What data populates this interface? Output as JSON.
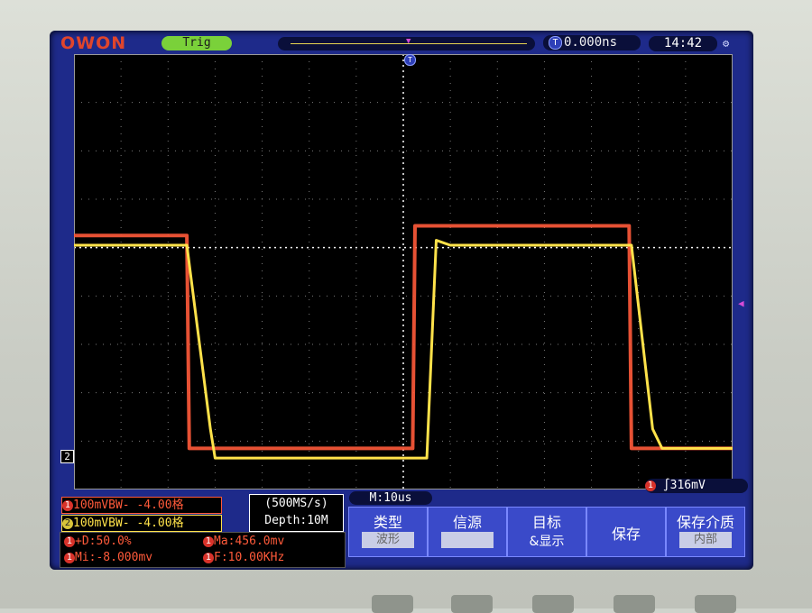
{
  "brand": "OWON",
  "trigger_status": "Trig",
  "trigger_offset": "0.000ns",
  "clock": "14:42",
  "channel1": {
    "marker": "1",
    "setting": "100mVBW- -4.00格",
    "color": "#ff5a3a"
  },
  "channel2": {
    "marker": "2",
    "setting": "100mVBW- -4.00格",
    "color": "#ffe24a"
  },
  "sample_rate": "(500MS/s)",
  "depth": "Depth:10M",
  "timebase": "M:10us",
  "trigger_config": {
    "source": "1",
    "level": "316mV"
  },
  "measurements": {
    "duty": "+D:50.0%",
    "max": "Ma:456.0mv",
    "min": "Mi:-8.000mv",
    "freq": "F:10.00KHz",
    "source": "1"
  },
  "menu": [
    {
      "title": "类型",
      "sub": "波形"
    },
    {
      "title": "信源",
      "sub": ""
    },
    {
      "title": "目标",
      "sub": "&显示"
    },
    {
      "title": "保存",
      "sub": ""
    },
    {
      "title": "保存介质",
      "sub": "内部"
    }
  ],
  "chart_data": {
    "type": "line",
    "title": "",
    "xlabel": "",
    "ylabel": "",
    "grid": true,
    "x_divisions": 14,
    "y_divisions": 9,
    "x_units_per_div": "10us",
    "series": [
      {
        "color": "#ff5a3a",
        "x": [
          0,
          2.4,
          2.45,
          7.2,
          7.25,
          11.8,
          11.85,
          14
        ],
        "y": [
          4.4,
          4.4,
          0.0,
          0.0,
          4.6,
          4.6,
          0.0,
          0.0
        ]
      },
      {
        "color": "#ffe24a",
        "x": [
          0,
          2.4,
          2.9,
          3.0,
          7.5,
          7.7,
          8.0,
          11.85,
          12.3,
          12.5,
          14
        ],
        "y": [
          4.2,
          4.2,
          0.4,
          -0.2,
          -0.2,
          4.3,
          4.2,
          4.2,
          0.4,
          0.0,
          0.0
        ]
      }
    ]
  }
}
